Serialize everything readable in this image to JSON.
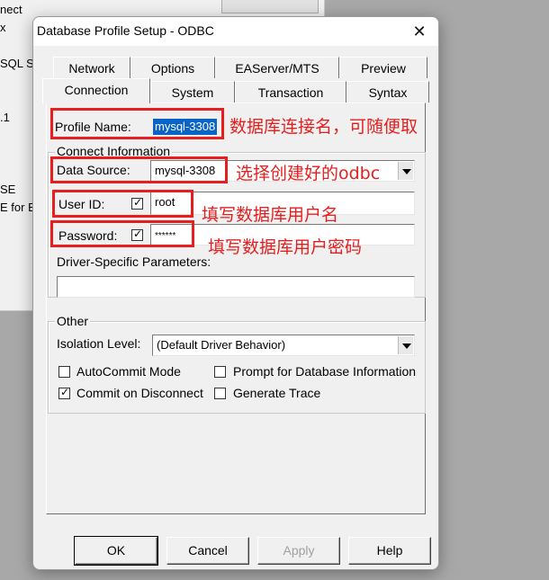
{
  "background_window": {
    "lines": [
      "nect",
      "x",
      "SQL S",
      ".1",
      "SE",
      "E for E"
    ]
  },
  "dialog": {
    "title": "Database Profile Setup - ODBC",
    "close_symbol": "✕",
    "tabs_row1": [
      "Network",
      "Options",
      "EAServer/MTS",
      "Preview"
    ],
    "tabs_row2": [
      "Connection",
      "System",
      "Transaction",
      "Syntax"
    ],
    "active_tab": "Connection",
    "profile_name_label": "Profile Name:",
    "profile_name_value": "mysql-3308",
    "connect_group_title": "Connect Information",
    "data_source_label": "Data Source:",
    "data_source_value": "mysql-3308",
    "user_id_label": "User ID:",
    "user_id_checked": true,
    "user_id_value": "root",
    "password_label": "Password:",
    "password_checked": true,
    "password_value": "******",
    "driver_params_label": "Driver-Specific Parameters:",
    "driver_params_value": "",
    "other_group_title": "Other",
    "isolation_label": "Isolation Level:",
    "isolation_value": "(Default Driver Behavior)",
    "checkboxes": {
      "autocommit": {
        "label": "AutoCommit Mode",
        "checked": false
      },
      "prompt_db_info": {
        "label": "Prompt for Database Information",
        "checked": false
      },
      "commit_on_disconnect": {
        "label": "Commit on Disconnect",
        "checked": true
      },
      "generate_trace": {
        "label": "Generate Trace",
        "checked": false
      }
    },
    "buttons": {
      "ok": "OK",
      "cancel": "Cancel",
      "apply": "Apply",
      "help": "Help"
    }
  },
  "annotations": {
    "profile_name_note": "数据库连接名，可随便取",
    "data_source_note": "选择创建好的odbc",
    "user_id_note": "填写数据库用户名",
    "password_note": "填写数据库用户密码",
    "color": "#e81e1e"
  }
}
